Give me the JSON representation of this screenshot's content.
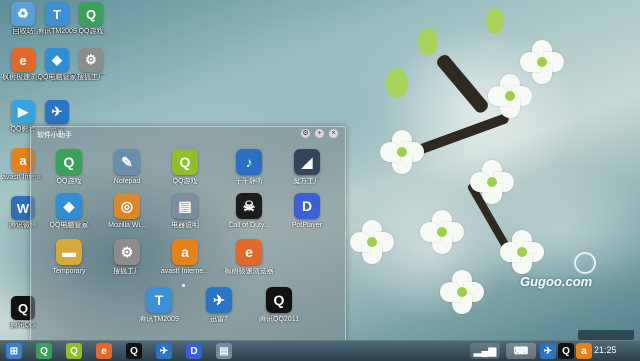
{
  "desktop": {
    "icons": [
      {
        "label": "回收站",
        "icon": "recycle-bin-icon",
        "glyph": "♻",
        "color": "#5aa0d8"
      },
      {
        "label": "腾讯TM2009",
        "icon": "tm-icon",
        "glyph": "T",
        "color": "#3d8fd6"
      },
      {
        "label": "QQ游戏",
        "icon": "qq-game-icon",
        "glyph": "Q",
        "color": "#3aa05a"
      },
      {
        "label": "枫树极速浏览器",
        "icon": "browser-icon",
        "glyph": "e",
        "color": "#e0692b"
      },
      {
        "label": "QQ电脑管家",
        "icon": "qq-guard-icon",
        "glyph": "◆",
        "color": "#2f8fd2"
      },
      {
        "label": "搜狐工厂",
        "icon": "factory-icon",
        "glyph": "⚙",
        "color": "#8c8c8c"
      },
      {
        "label": "QQ影音",
        "icon": "qq-player-icon",
        "glyph": "▶",
        "color": "#3aa2dd"
      },
      {
        "label": "迅雷",
        "icon": "thunder-icon",
        "glyph": "✈",
        "color": "#2a74c6"
      },
      {
        "label": "avast! Intern...",
        "icon": "avast-icon",
        "glyph": "a",
        "color": "#e5821c"
      },
      {
        "label": "腾讯微博",
        "icon": "weibo-icon",
        "glyph": "W",
        "color": "#2f6fb5"
      },
      {
        "label": "腾讯QQ",
        "icon": "qq-icon",
        "glyph": "Q",
        "color": "#111111"
      }
    ]
  },
  "panel": {
    "title": "软件小助手",
    "icons": [
      {
        "label": "QQ游戏",
        "icon": "qq-game-icon",
        "glyph": "Q",
        "color": "#3aa05a"
      },
      {
        "label": "Notepad",
        "icon": "notepad-icon",
        "glyph": "✎",
        "color": "#6b8fa8"
      },
      {
        "label": "QQ游戏",
        "icon": "qq-game-icon",
        "glyph": "Q",
        "color": "#8fbf2a"
      },
      {
        "label": "千千静听",
        "icon": "music-icon",
        "glyph": "♪",
        "color": "#2b6fc0"
      },
      {
        "label": "魔方工厂",
        "icon": "cube-icon",
        "glyph": "◢",
        "color": "#35445a"
      },
      {
        "label": "QQ电脑管家",
        "icon": "qq-guard-icon",
        "glyph": "◆",
        "color": "#2f8fd2"
      },
      {
        "label": "Mozilla Wi...",
        "icon": "firefox-icon",
        "glyph": "◎",
        "color": "#d9882a"
      },
      {
        "label": "电器说明",
        "icon": "manual-icon",
        "glyph": "▤",
        "color": "#7b8ea0"
      },
      {
        "label": "Call of Duty...",
        "icon": "skull-icon",
        "glyph": "☠",
        "color": "#1c1c1c"
      },
      {
        "label": "PotPlayer",
        "icon": "potplayer-icon",
        "glyph": "D",
        "color": "#3b5fd6"
      },
      {
        "label": "Temporary",
        "icon": "folder-icon",
        "glyph": "▬",
        "color": "#d8a93a"
      },
      {
        "label": "搜狐工厂",
        "icon": "factory-icon",
        "glyph": "⚙",
        "color": "#8c8c8c"
      },
      {
        "label": "avast! Interne...",
        "icon": "avast-icon",
        "glyph": "a",
        "color": "#e5821c"
      },
      {
        "label": "枫树极速浏览器",
        "icon": "browser-icon",
        "glyph": "e",
        "color": "#e0692b"
      },
      {
        "label": "腾讯TM2009",
        "icon": "tm-icon",
        "glyph": "T",
        "color": "#3d8fd6"
      },
      {
        "label": "迅雷7",
        "icon": "thunder-icon",
        "glyph": "✈",
        "color": "#2a74c6"
      },
      {
        "label": "腾讯QQ2011",
        "icon": "qq-icon",
        "glyph": "Q",
        "color": "#111111"
      }
    ]
  },
  "watermark": "Gugoo.com",
  "taskbar": {
    "items": [
      {
        "icon": "start-icon",
        "glyph": "⊞",
        "color": "#3b7fd0"
      },
      {
        "icon": "qq-game-icon",
        "glyph": "Q",
        "color": "#3aa05a"
      },
      {
        "icon": "qq-game-icon",
        "glyph": "Q",
        "color": "#8fbf2a"
      },
      {
        "icon": "browser-icon",
        "glyph": "e",
        "color": "#e0692b"
      },
      {
        "icon": "qq-icon",
        "glyph": "Q",
        "color": "#111111"
      },
      {
        "icon": "thunder-icon",
        "glyph": "✈",
        "color": "#2a74c6"
      },
      {
        "icon": "potplayer-icon",
        "glyph": "D",
        "color": "#3b5fd6"
      },
      {
        "icon": "explorer-icon",
        "glyph": "▤",
        "color": "#6b8fa8"
      }
    ],
    "clock": "21:25"
  }
}
